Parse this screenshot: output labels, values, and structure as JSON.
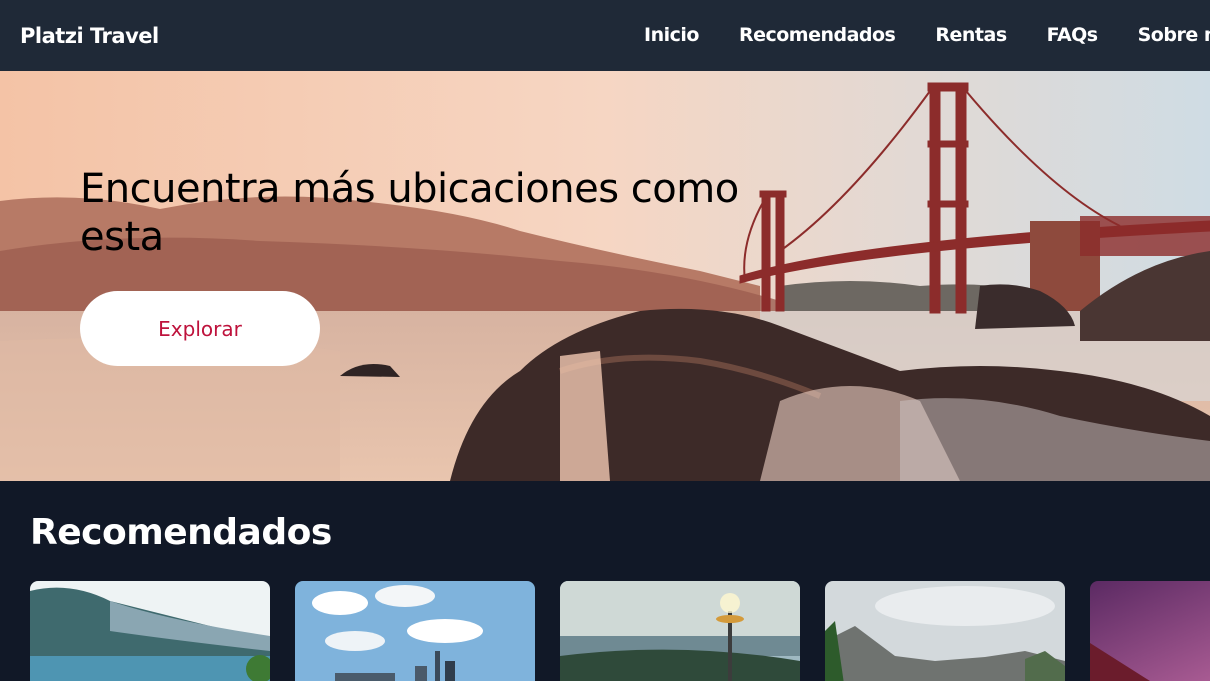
{
  "header": {
    "logo": "Platzi Travel",
    "nav": [
      {
        "label": "Inicio"
      },
      {
        "label": "Recomendados"
      },
      {
        "label": "Rentas"
      },
      {
        "label": "FAQs"
      },
      {
        "label": "Sobre nosotros"
      }
    ]
  },
  "hero": {
    "title": "Encuentra más ubicaciones como esta",
    "button_label": "Explorar"
  },
  "recommended": {
    "title": "Recomendados",
    "cards": [
      {
        "image": "lake-mountains"
      },
      {
        "image": "city-skyline"
      },
      {
        "image": "space-needle"
      },
      {
        "image": "yosemite-valley"
      },
      {
        "image": "purple-sky"
      }
    ]
  },
  "colors": {
    "header_bg": "#1f2937",
    "page_bg": "#111827",
    "accent": "#be123c"
  }
}
